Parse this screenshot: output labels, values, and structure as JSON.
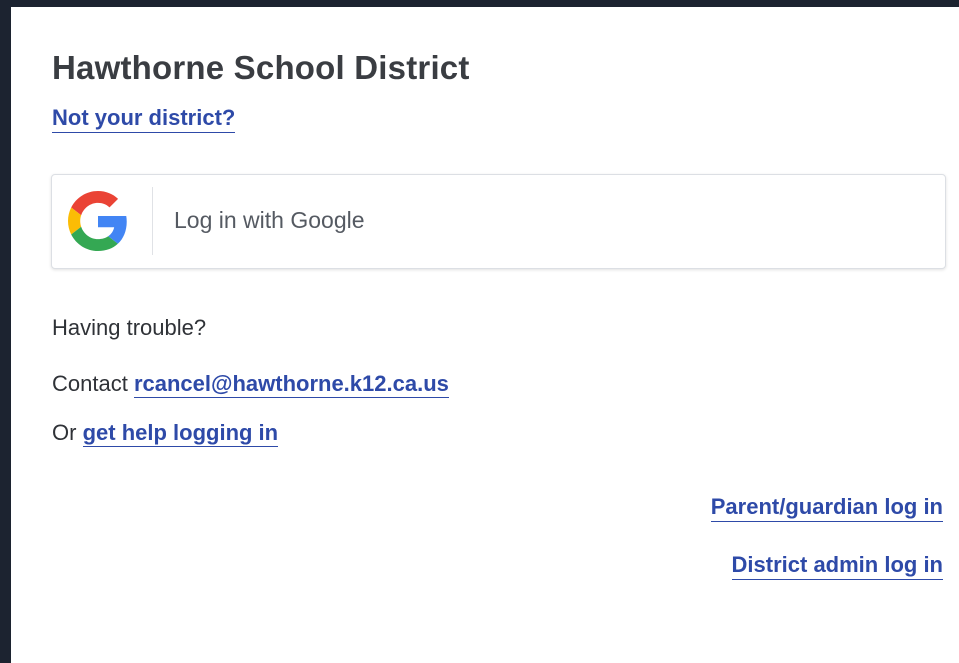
{
  "district": {
    "title": "Hawthorne School District",
    "not_your_district": "Not your district?"
  },
  "login": {
    "google_label": "Log in with Google",
    "google_icon": "google-g-icon"
  },
  "help": {
    "trouble_text": "Having trouble?",
    "contact_prefix": "Contact",
    "contact_email": "rcancel@hawthorne.k12.ca.us",
    "or_prefix": "Or",
    "help_link": "get help logging in"
  },
  "alt_logins": {
    "parent": "Parent/guardian log in",
    "admin": "District admin log in"
  },
  "colors": {
    "link": "#2e4aa8",
    "background_frame": "#1c2330"
  }
}
